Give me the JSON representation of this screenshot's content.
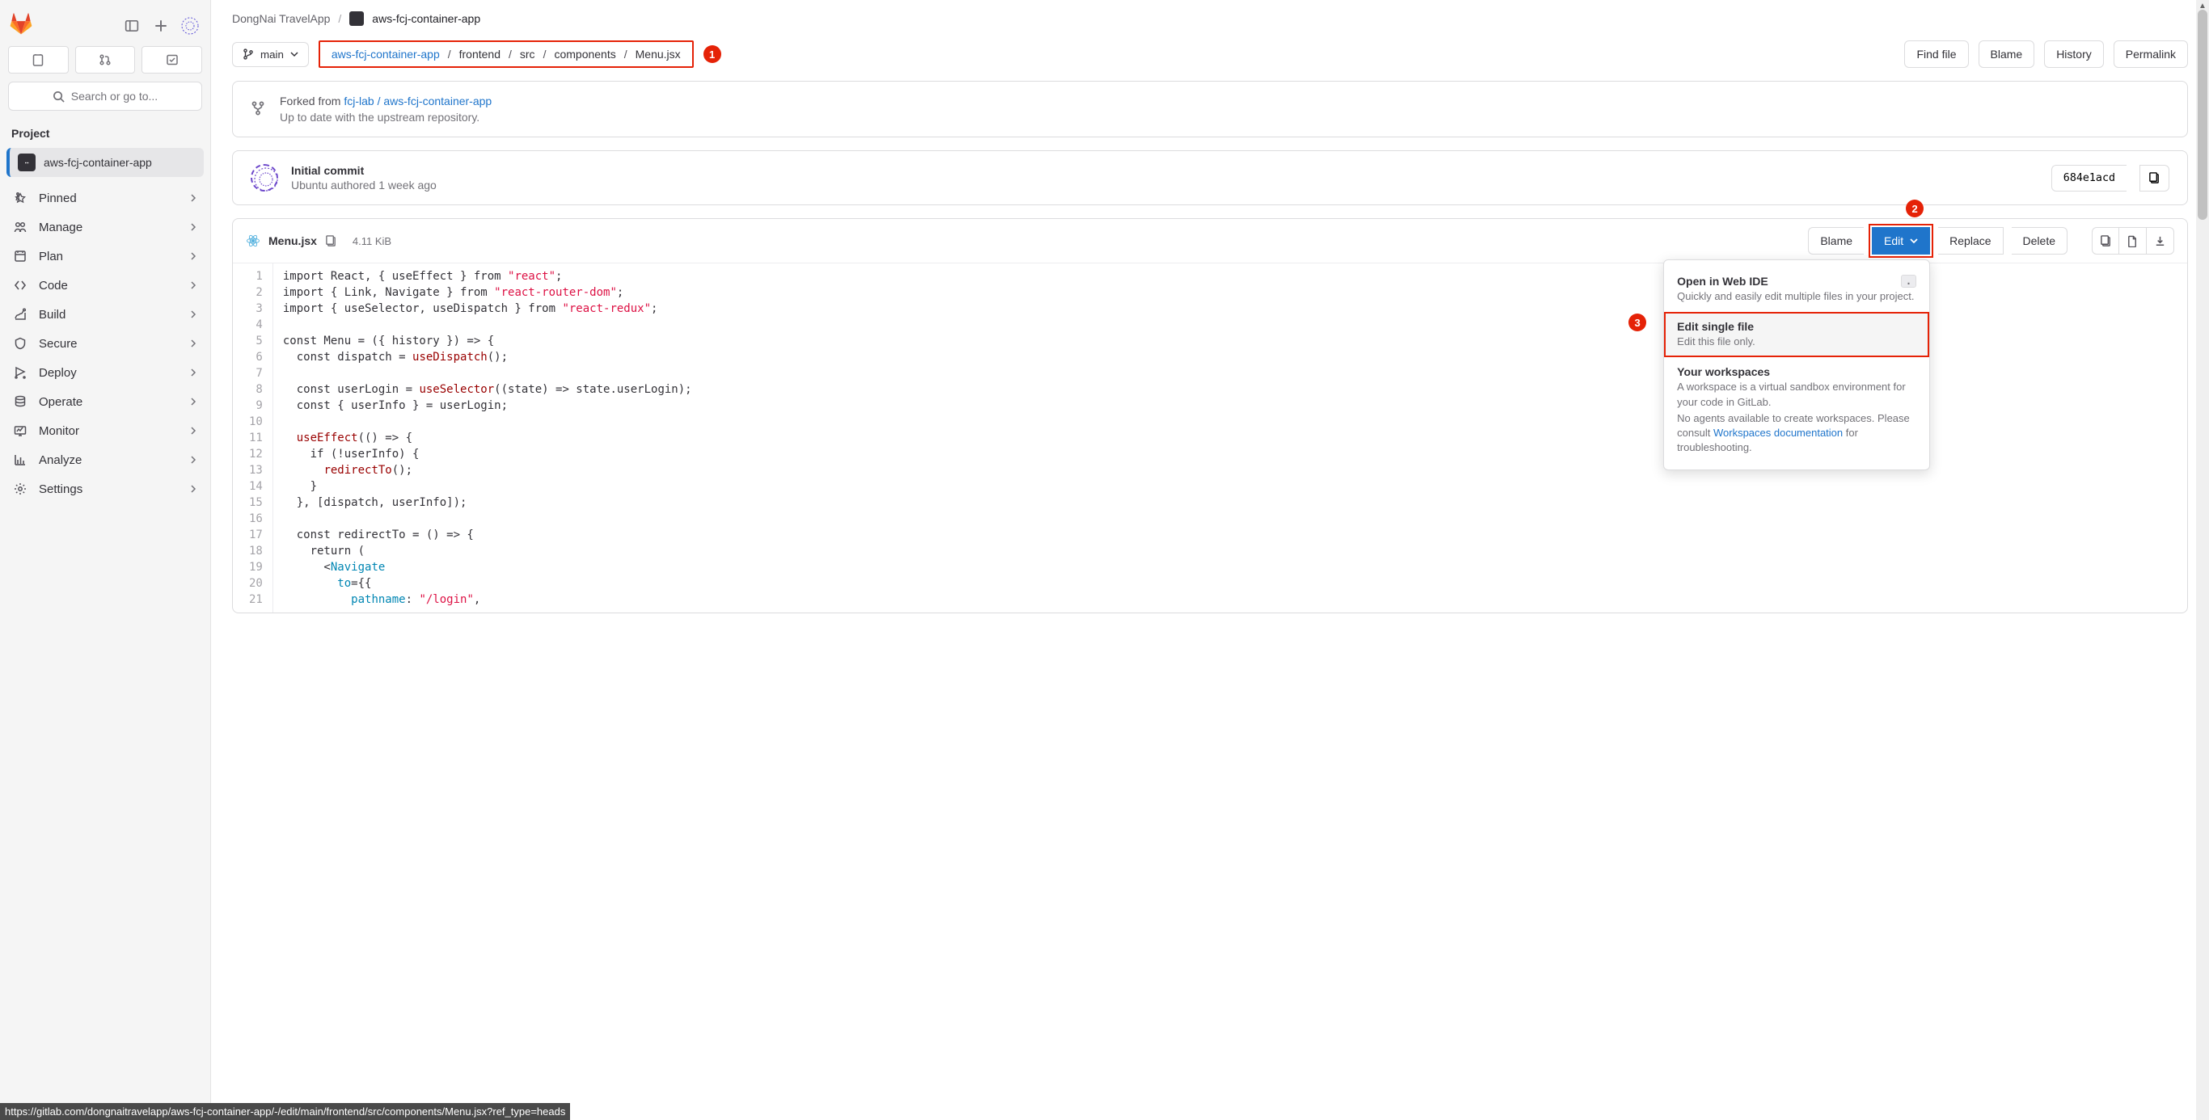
{
  "header": {
    "search_placeholder": "Search or go to..."
  },
  "sidebar": {
    "heading": "Project",
    "project_name": "aws-fcj-container-app",
    "items": [
      {
        "label": "Pinned"
      },
      {
        "label": "Manage"
      },
      {
        "label": "Plan"
      },
      {
        "label": "Code"
      },
      {
        "label": "Build"
      },
      {
        "label": "Secure"
      },
      {
        "label": "Deploy"
      },
      {
        "label": "Operate"
      },
      {
        "label": "Monitor"
      },
      {
        "label": "Analyze"
      },
      {
        "label": "Settings"
      }
    ]
  },
  "breadcrumb": {
    "group": "DongNai TravelApp",
    "project": "aws-fcj-container-app"
  },
  "branch": "main",
  "path": [
    "aws-fcj-container-app",
    "frontend",
    "src",
    "components",
    "Menu.jsx"
  ],
  "actions": {
    "find_file": "Find file",
    "blame": "Blame",
    "history": "History",
    "permalink": "Permalink"
  },
  "fork": {
    "prefix": "Forked from ",
    "link": "fcj-lab / aws-fcj-container-app",
    "status": "Up to date with the upstream repository."
  },
  "commit": {
    "message": "Initial commit",
    "author": "Ubuntu",
    "authored": " authored ",
    "when": "1 week ago",
    "hash": "684e1acd"
  },
  "file": {
    "name": "Menu.jsx",
    "size": "4.11 KiB",
    "blame": "Blame",
    "edit": "Edit",
    "replace": "Replace",
    "delete": "Delete"
  },
  "dropdown": {
    "web_ide_title": "Open in Web IDE",
    "web_ide_kbd": ".",
    "web_ide_desc": "Quickly and easily edit multiple files in your project.",
    "single_title": "Edit single file",
    "single_desc": "Edit this file only.",
    "ws_title": "Your workspaces",
    "ws_desc1": "A workspace is a virtual sandbox environment for your code in GitLab.",
    "ws_desc2a": "No agents available to create workspaces. Please consult ",
    "ws_link": "Workspaces documentation",
    "ws_desc2b": " for troubleshooting."
  },
  "code": {
    "lines": [
      [
        [
          "import React, { useEffect } from ",
          ""
        ],
        [
          "\"react\"",
          "str"
        ],
        [
          ";",
          ""
        ]
      ],
      [
        [
          "import { Link, Navigate } from ",
          ""
        ],
        [
          "\"react-router-dom\"",
          "str"
        ],
        [
          ";",
          ""
        ]
      ],
      [
        [
          "import { useSelector, useDispatch } from ",
          ""
        ],
        [
          "\"react-redux\"",
          "str"
        ],
        [
          ";",
          ""
        ]
      ],
      [
        [
          "",
          ""
        ]
      ],
      [
        [
          "const Menu = ({ history }) => {",
          ""
        ]
      ],
      [
        [
          "  const dispatch = ",
          ""
        ],
        [
          "useDispatch",
          "fn"
        ],
        [
          "();",
          ""
        ]
      ],
      [
        [
          "",
          ""
        ]
      ],
      [
        [
          "  const userLogin = ",
          ""
        ],
        [
          "useSelector",
          "fn"
        ],
        [
          "((state) => state.userLogin);",
          ""
        ]
      ],
      [
        [
          "  const { userInfo } = userLogin;",
          ""
        ]
      ],
      [
        [
          "",
          ""
        ]
      ],
      [
        [
          "  ",
          ""
        ],
        [
          "useEffect",
          "fn"
        ],
        [
          "(() => {",
          ""
        ]
      ],
      [
        [
          "    if (!userInfo) {",
          ""
        ]
      ],
      [
        [
          "      ",
          ""
        ],
        [
          "redirectTo",
          "fn"
        ],
        [
          "();",
          ""
        ]
      ],
      [
        [
          "    }",
          ""
        ]
      ],
      [
        [
          "  }, [dispatch, userInfo]);",
          ""
        ]
      ],
      [
        [
          "",
          ""
        ]
      ],
      [
        [
          "  const redirectTo = () => {",
          ""
        ]
      ],
      [
        [
          "    return (",
          ""
        ]
      ],
      [
        [
          "      <",
          ""
        ],
        [
          "Navigate",
          "call"
        ],
        [
          "",
          ""
        ]
      ],
      [
        [
          "        ",
          ""
        ],
        [
          "to",
          "call"
        ],
        [
          "={{",
          ""
        ]
      ],
      [
        [
          "          ",
          ""
        ],
        [
          "pathname",
          "call"
        ],
        [
          ": ",
          ""
        ],
        [
          "\"/login\"",
          "str"
        ],
        [
          ",",
          ""
        ]
      ]
    ]
  },
  "status_url": "https://gitlab.com/dongnaitravelapp/aws-fcj-container-app/-/edit/main/frontend/src/components/Menu.jsx?ref_type=heads"
}
